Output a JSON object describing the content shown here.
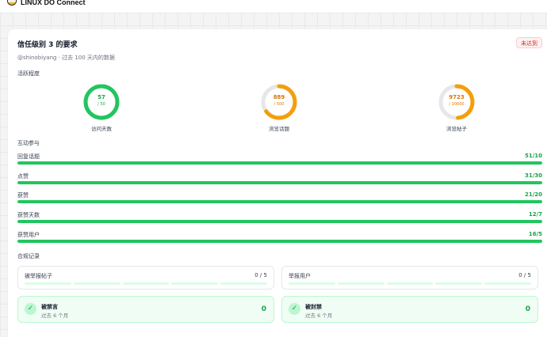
{
  "app": {
    "brand": "LINUX DO Connect"
  },
  "header": {
    "title": "信任级别 3 的要求",
    "badge": "未达到",
    "subtitle": "@shinobiyang · 过去 100 天内的数据"
  },
  "activity": {
    "label": "活跃程度",
    "rings": [
      {
        "value": "57",
        "max": "/ 50",
        "caption": "访问天数",
        "progress": 1.0,
        "color": "#22c55e"
      },
      {
        "value": "889",
        "max": "/ 500",
        "caption": "浏览话题",
        "progress": 0.65,
        "color": "#f59e0b"
      },
      {
        "value": "9723",
        "max": "/ 20000",
        "caption": "浏览帖子",
        "progress": 0.486,
        "color": "#f59e0b"
      }
    ]
  },
  "interaction": {
    "label": "互动参与",
    "bars": [
      {
        "label": "回复话题",
        "value": "51/10",
        "progress": 1.0
      },
      {
        "label": "点赞",
        "value": "31/30",
        "progress": 1.0
      },
      {
        "label": "获赞",
        "value": "21/20",
        "progress": 1.0
      },
      {
        "label": "获赞天数",
        "value": "12/7",
        "progress": 1.0
      },
      {
        "label": "获赞用户",
        "value": "16/5",
        "progress": 1.0
      }
    ]
  },
  "compliance": {
    "label": "合规记录",
    "reports": [
      {
        "label": "被举报帖子",
        "count": "0 / 5"
      },
      {
        "label": "举报用户",
        "count": "0 / 5"
      }
    ],
    "statuses": [
      {
        "title": "被禁言",
        "sub": "过去 6 个月",
        "count": "0",
        "icon": "check-icon"
      },
      {
        "title": "被封禁",
        "sub": "过去 6 个月",
        "count": "0",
        "icon": "check-icon"
      }
    ]
  },
  "colors": {
    "green": "#22c55e",
    "orange": "#f59e0b",
    "track": "#e5e7eb",
    "red": "#dc2626"
  }
}
